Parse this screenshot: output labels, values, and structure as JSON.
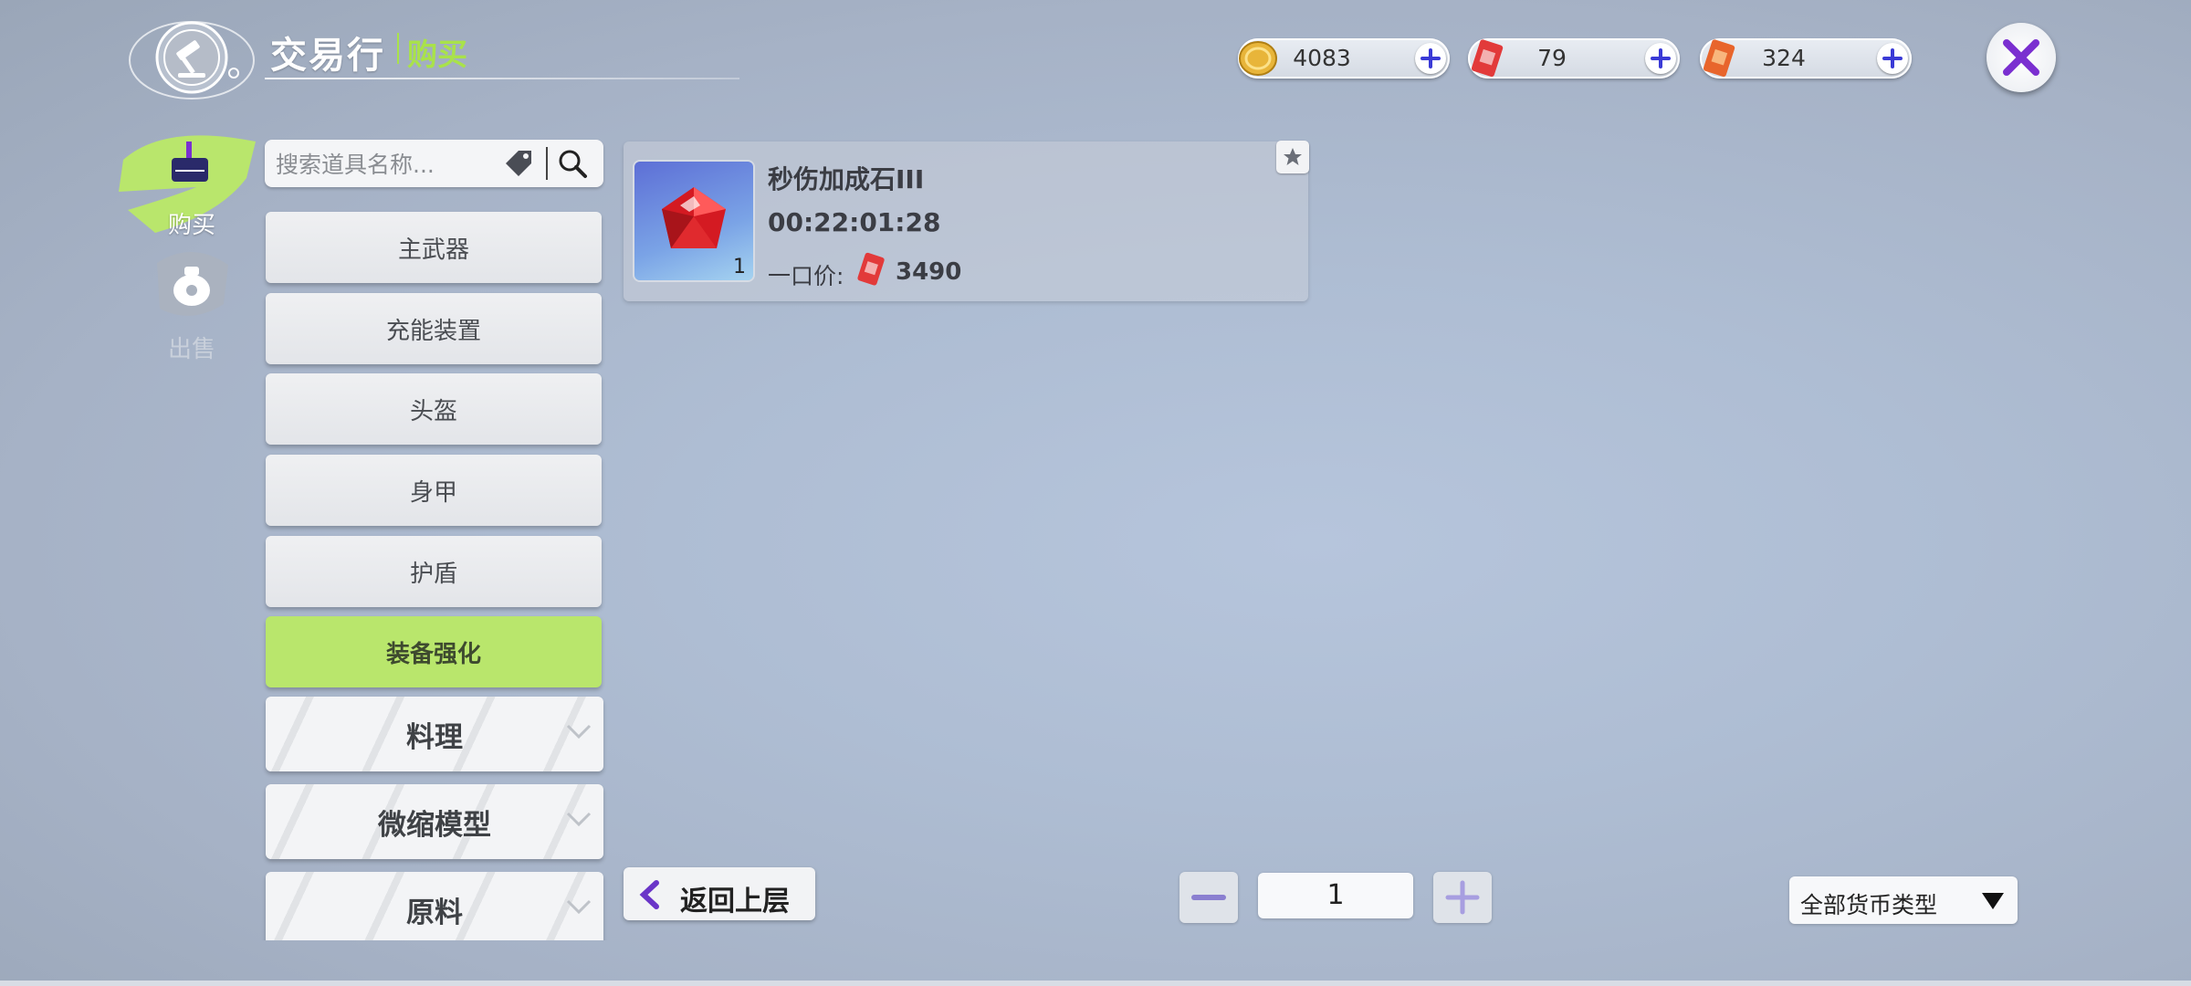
{
  "header": {
    "title": "交易行",
    "subtitle": "购买"
  },
  "currencies": [
    {
      "icon": "gold-coin-icon",
      "value": "4083"
    },
    {
      "icon": "red-ticket-icon",
      "value": "79"
    },
    {
      "icon": "orange-ticket-icon",
      "value": "324"
    }
  ],
  "side_tabs": {
    "buy_label": "购买",
    "sell_label": "出售"
  },
  "search": {
    "placeholder": "搜索道具名称..."
  },
  "categories": [
    {
      "label": "主武器"
    },
    {
      "label": "充能装置"
    },
    {
      "label": "头盔"
    },
    {
      "label": "身甲"
    },
    {
      "label": "护盾"
    },
    {
      "label": "装备强化",
      "selected": true
    }
  ],
  "category_groups": [
    {
      "label": "料理"
    },
    {
      "label": "微缩模型"
    },
    {
      "label": "原料"
    }
  ],
  "listing": {
    "name": "秒伤加成石III",
    "time_left": "00:22:01:28",
    "price_label": "一口价:",
    "price": "3490",
    "quantity": "1",
    "item_icon": "red-gem-icon"
  },
  "bottom": {
    "back_label": "返回上层",
    "page": "1",
    "currency_filter": "全部货币类型"
  },
  "colors": {
    "accent_green": "#b9e66c",
    "subtitle_green": "#a9e24a",
    "close_purple": "#7a2fd0"
  }
}
